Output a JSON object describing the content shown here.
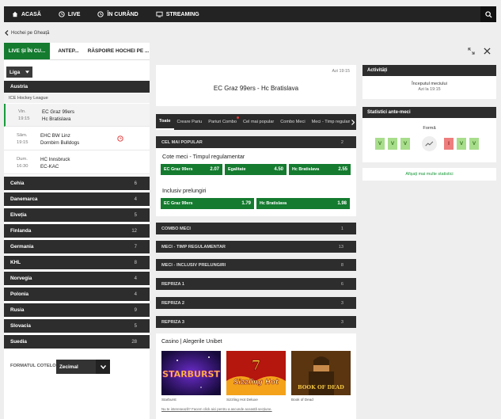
{
  "nav": {
    "items": [
      {
        "label": "ACASĂ",
        "icon": "home-icon"
      },
      {
        "label": "LIVE",
        "icon": "clock-icon"
      },
      {
        "label": "ÎN CURÂND",
        "icon": "clock-icon"
      },
      {
        "label": "STREAMING",
        "icon": "tv-icon"
      }
    ]
  },
  "breadcrumb": "Hochei pe Gheață",
  "left": {
    "tabs": [
      "LIVE ȘI ÎN CU...",
      "ANTEP...",
      "RĂSPOIRE HOCHEI PE ..."
    ],
    "liga_label": "Liga",
    "country_head": "Austria",
    "league": "ICE Hockey League",
    "matches": [
      {
        "day": "Vin.",
        "time": "19:15",
        "home": "EC Graz 99ers",
        "away": "Hc Bratislava"
      },
      {
        "day": "Sâm.",
        "time": "19:15",
        "home": "EHC BW Linz",
        "away": "Dornbirn Bulldogs"
      },
      {
        "day": "Dum.",
        "time": "16:30",
        "home": "HC Innsbruck",
        "away": "EC-KAC"
      }
    ],
    "countries": [
      {
        "name": "Cehia",
        "count": "6"
      },
      {
        "name": "Danemarca",
        "count": "4"
      },
      {
        "name": "Elveția",
        "count": "5"
      },
      {
        "name": "Finlanda",
        "count": "12"
      },
      {
        "name": "Germania",
        "count": "7"
      },
      {
        "name": "KHL",
        "count": "8"
      },
      {
        "name": "Norvegia",
        "count": "4"
      },
      {
        "name": "Polonia",
        "count": "4"
      },
      {
        "name": "Rusia",
        "count": "9"
      },
      {
        "name": "Slovacia",
        "count": "5"
      },
      {
        "name": "Suedia",
        "count": "28"
      }
    ],
    "odds_format_label": "FORMATUL COTELOR",
    "odds_format_value": "Zecimal"
  },
  "center": {
    "match_time": "Azi 19:15",
    "match_title": "EC Graz 99ers - Hc Bratislava",
    "tabs": [
      "Toate",
      "Creare Pariu",
      "Pariuri Combo",
      "Cel mai popular",
      "Combo Meci",
      "Meci - Timp regulamentar"
    ],
    "popular_bar": {
      "label": "CEL MAI POPULAR",
      "count": "2"
    },
    "market1": {
      "title": "Cote meci - Timpul regulamentar",
      "odds": [
        {
          "label": "EC Graz 99ers",
          "price": "2.07"
        },
        {
          "label": "Egalitate",
          "price": "4.50"
        },
        {
          "label": "Hc Bratislava",
          "price": "2.55"
        }
      ]
    },
    "market2": {
      "title": "Inclusiv prelungiri",
      "odds": [
        {
          "label": "EC Graz 99ers",
          "price": "1.79"
        },
        {
          "label": "Hc Bratislava",
          "price": "1.98"
        }
      ]
    },
    "sections": [
      {
        "label": "COMBO MECI",
        "count": "1"
      },
      {
        "label": "MECI - TIMP REGULAMENTAR",
        "count": "13"
      },
      {
        "label": "MECI - INCLUSIV PRELUNGIRI",
        "count": "8"
      },
      {
        "label": "REPRIZA 1",
        "count": "6"
      },
      {
        "label": "REPRIZA 2",
        "count": "3"
      },
      {
        "label": "REPRIZA 3",
        "count": "3"
      }
    ],
    "casino": {
      "title": "Casino | Alegerile Unibet",
      "games": [
        "Starburst",
        "Sizzling Hot Deluxe",
        "Book of Dead"
      ],
      "game_art_text": [
        "STARBURST",
        "Sizzling Hot",
        "BOOK OF DEAD"
      ],
      "disclaimer": "Nu te interesează? Facem click aici pentru a ascunde această secțiune."
    }
  },
  "right": {
    "activity_title": "Activități",
    "event": "Începutul meciului",
    "event_time": "Azi la 19:15",
    "stats_title": "Statistici ante-meci",
    "form_label": "Formă",
    "home_form": [
      "V",
      "V",
      "V"
    ],
    "away_form": [
      "I",
      "V",
      "V"
    ],
    "more_stats": "Afișați mai multe statistici"
  },
  "colors": {
    "accent": "#147b2f",
    "dark": "#2d2d2d",
    "win": "#a8dd8c",
    "loss": "#ee7d7d"
  }
}
